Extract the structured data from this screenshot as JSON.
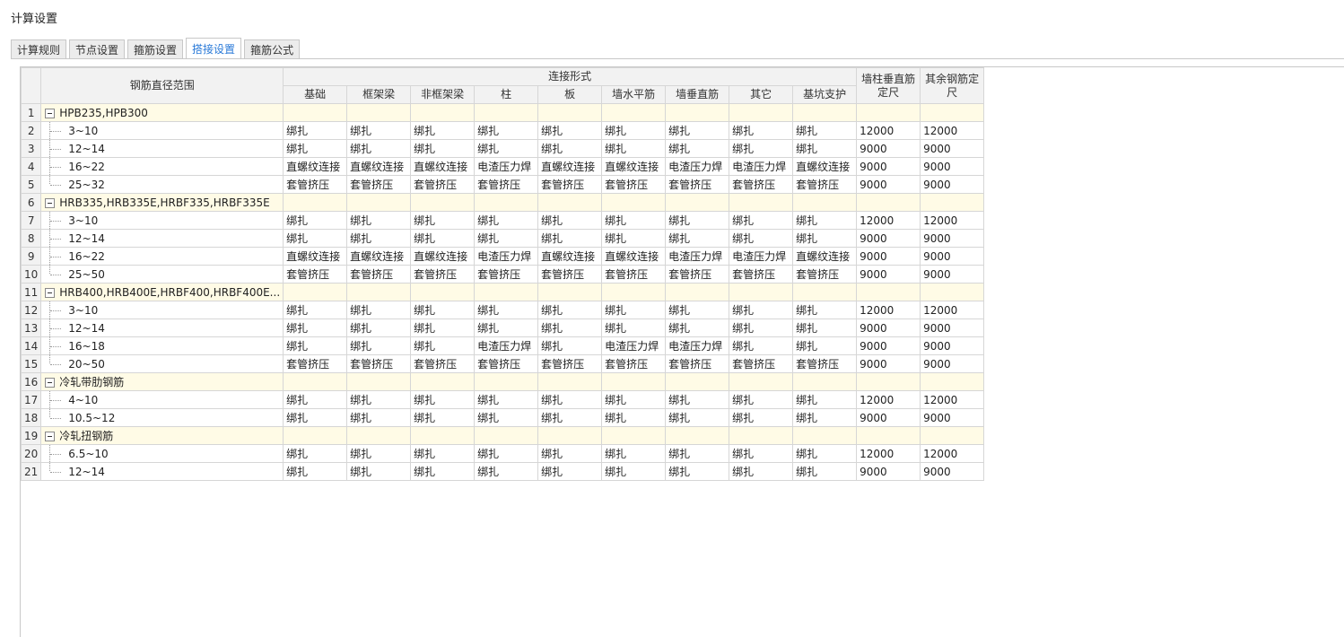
{
  "window": {
    "title": "计算设置"
  },
  "tabs": [
    {
      "label": "计算规则",
      "active": false
    },
    {
      "label": "节点设置",
      "active": false
    },
    {
      "label": "箍筋设置",
      "active": false
    },
    {
      "label": "搭接设置",
      "active": true
    },
    {
      "label": "箍筋公式",
      "active": false
    }
  ],
  "table": {
    "headers": {
      "range": "钢筋直径范围",
      "connection_group": "连接形式",
      "columns": [
        "基础",
        "框架梁",
        "非框架梁",
        "柱",
        "板",
        "墙水平筋",
        "墙垂直筋",
        "其它",
        "基坑支护"
      ],
      "wall_vertical_length": "墙柱垂直筋定尺",
      "other_length": "其余钢筋定尺"
    },
    "rows": [
      {
        "n": "1",
        "group": true,
        "label": "HPB235,HPB300"
      },
      {
        "n": "2",
        "label": "3~10",
        "cells": [
          "绑扎",
          "绑扎",
          "绑扎",
          "绑扎",
          "绑扎",
          "绑扎",
          "绑扎",
          "绑扎",
          "绑扎"
        ],
        "wall": "12000",
        "other": "12000"
      },
      {
        "n": "3",
        "label": "12~14",
        "cells": [
          "绑扎",
          "绑扎",
          "绑扎",
          "绑扎",
          "绑扎",
          "绑扎",
          "绑扎",
          "绑扎",
          "绑扎"
        ],
        "wall": "9000",
        "other": "9000"
      },
      {
        "n": "4",
        "label": "16~22",
        "cells": [
          "直螺纹连接",
          "直螺纹连接",
          "直螺纹连接",
          "电渣压力焊",
          "直螺纹连接",
          "直螺纹连接",
          "电渣压力焊",
          "电渣压力焊",
          "直螺纹连接"
        ],
        "wall": "9000",
        "other": "9000"
      },
      {
        "n": "5",
        "label": "25~32",
        "last": true,
        "cells": [
          "套管挤压",
          "套管挤压",
          "套管挤压",
          "套管挤压",
          "套管挤压",
          "套管挤压",
          "套管挤压",
          "套管挤压",
          "套管挤压"
        ],
        "wall": "9000",
        "other": "9000"
      },
      {
        "n": "6",
        "group": true,
        "label": "HRB335,HRB335E,HRBF335,HRBF335E"
      },
      {
        "n": "7",
        "label": "3~10",
        "cells": [
          "绑扎",
          "绑扎",
          "绑扎",
          "绑扎",
          "绑扎",
          "绑扎",
          "绑扎",
          "绑扎",
          "绑扎"
        ],
        "wall": "12000",
        "other": "12000"
      },
      {
        "n": "8",
        "label": "12~14",
        "cells": [
          "绑扎",
          "绑扎",
          "绑扎",
          "绑扎",
          "绑扎",
          "绑扎",
          "绑扎",
          "绑扎",
          "绑扎"
        ],
        "wall": "9000",
        "other": "9000"
      },
      {
        "n": "9",
        "label": "16~22",
        "cells": [
          "直螺纹连接",
          "直螺纹连接",
          "直螺纹连接",
          "电渣压力焊",
          "直螺纹连接",
          "直螺纹连接",
          "电渣压力焊",
          "电渣压力焊",
          "直螺纹连接"
        ],
        "wall": "9000",
        "other": "9000"
      },
      {
        "n": "10",
        "label": "25~50",
        "last": true,
        "cells": [
          "套管挤压",
          "套管挤压",
          "套管挤压",
          "套管挤压",
          "套管挤压",
          "套管挤压",
          "套管挤压",
          "套管挤压",
          "套管挤压"
        ],
        "wall": "9000",
        "other": "9000"
      },
      {
        "n": "11",
        "group": true,
        "label": "HRB400,HRB400E,HRBF400,HRBF400E..."
      },
      {
        "n": "12",
        "label": "3~10",
        "cells": [
          "绑扎",
          "绑扎",
          "绑扎",
          "绑扎",
          "绑扎",
          "绑扎",
          "绑扎",
          "绑扎",
          "绑扎"
        ],
        "wall": "12000",
        "other": "12000"
      },
      {
        "n": "13",
        "label": "12~14",
        "cells": [
          "绑扎",
          "绑扎",
          "绑扎",
          "绑扎",
          "绑扎",
          "绑扎",
          "绑扎",
          "绑扎",
          "绑扎"
        ],
        "wall": "9000",
        "other": "9000"
      },
      {
        "n": "14",
        "label": "16~18",
        "cells": [
          "绑扎",
          "绑扎",
          "绑扎",
          "电渣压力焊",
          "绑扎",
          "电渣压力焊",
          "电渣压力焊",
          "绑扎",
          "绑扎"
        ],
        "wall": "9000",
        "other": "9000"
      },
      {
        "n": "15",
        "label": "20~50",
        "last": true,
        "cells": [
          "套管挤压",
          "套管挤压",
          "套管挤压",
          "套管挤压",
          "套管挤压",
          "套管挤压",
          "套管挤压",
          "套管挤压",
          "套管挤压"
        ],
        "wall": "9000",
        "other": "9000"
      },
      {
        "n": "16",
        "group": true,
        "label": "冷轧带肋钢筋"
      },
      {
        "n": "17",
        "label": "4~10",
        "cells": [
          "绑扎",
          "绑扎",
          "绑扎",
          "绑扎",
          "绑扎",
          "绑扎",
          "绑扎",
          "绑扎",
          "绑扎"
        ],
        "wall": "12000",
        "other": "12000"
      },
      {
        "n": "18",
        "label": "10.5~12",
        "last": true,
        "cells": [
          "绑扎",
          "绑扎",
          "绑扎",
          "绑扎",
          "绑扎",
          "绑扎",
          "绑扎",
          "绑扎",
          "绑扎"
        ],
        "wall": "9000",
        "other": "9000"
      },
      {
        "n": "19",
        "group": true,
        "label": "冷轧扭钢筋"
      },
      {
        "n": "20",
        "label": "6.5~10",
        "cells": [
          "绑扎",
          "绑扎",
          "绑扎",
          "绑扎",
          "绑扎",
          "绑扎",
          "绑扎",
          "绑扎",
          "绑扎"
        ],
        "wall": "12000",
        "other": "12000"
      },
      {
        "n": "21",
        "label": "12~14",
        "last": true,
        "cells": [
          "绑扎",
          "绑扎",
          "绑扎",
          "绑扎",
          "绑扎",
          "绑扎",
          "绑扎",
          "绑扎",
          "绑扎"
        ],
        "wall": "9000",
        "other": "9000"
      }
    ]
  }
}
